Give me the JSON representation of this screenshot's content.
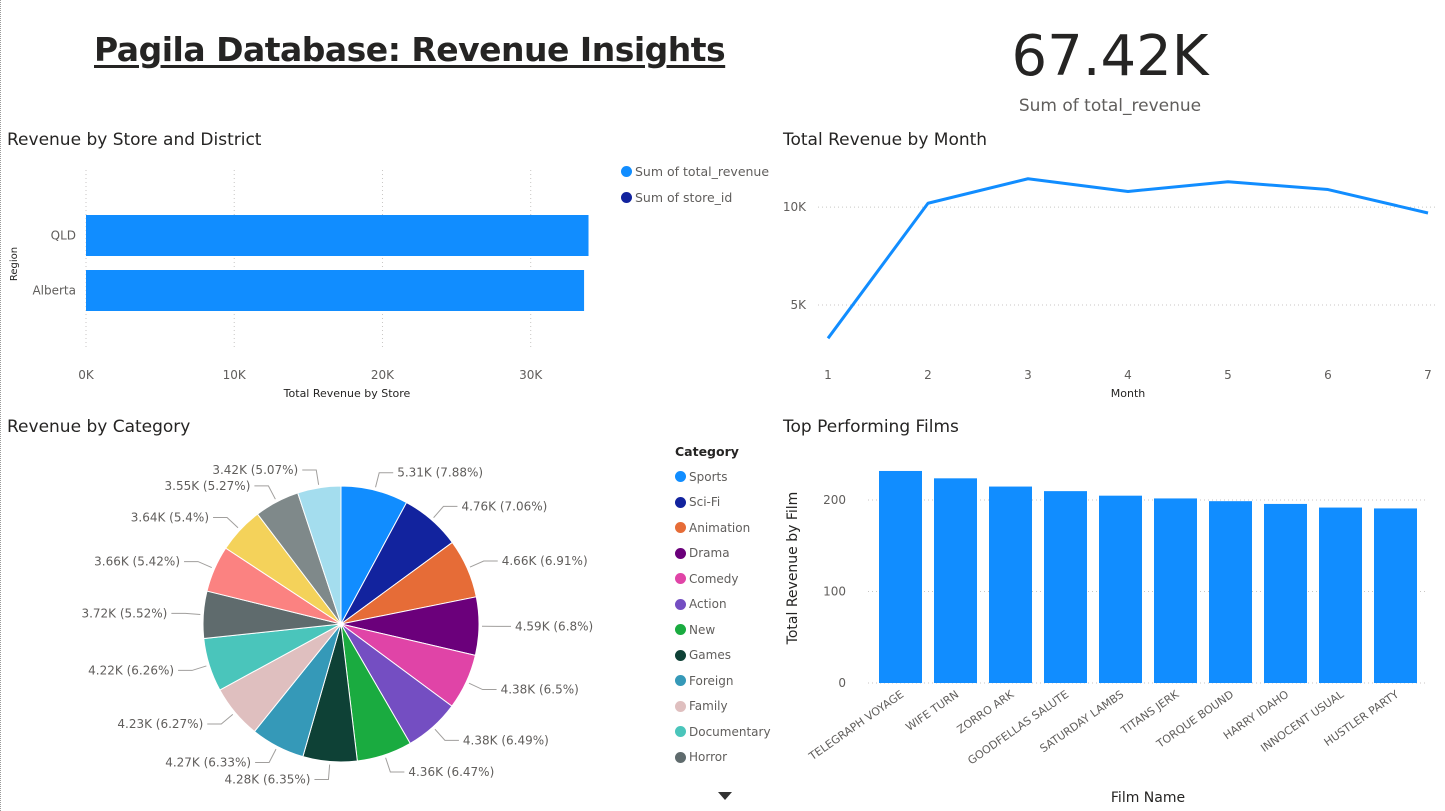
{
  "header": {
    "title": "Pagila Database: Revenue Insights",
    "kpi_value": "67.42K",
    "kpi_label": "Sum of total_revenue"
  },
  "colors": {
    "primary": "#118DFF",
    "secondary": "#12239E",
    "text": "#252423",
    "muted": "#605e5c"
  },
  "chart_data": [
    {
      "type": "bar",
      "orientation": "horizontal",
      "title": "Revenue by Store and District",
      "xlabel": "Total Revenue by Store",
      "ylabel": "Region",
      "categories": [
        "QLD",
        "Alberta"
      ],
      "series": [
        {
          "name": "Sum of total_revenue",
          "color": "#118DFF",
          "values": [
            33900,
            33600
          ]
        },
        {
          "name": "Sum of store_id",
          "color": "#12239E",
          "values": [
            2,
            1
          ]
        }
      ],
      "xlim": [
        0,
        34000
      ],
      "xticks": [
        0,
        10000,
        20000,
        30000
      ],
      "xtick_labels": [
        "0K",
        "10K",
        "20K",
        "30K"
      ],
      "legend": "top-right",
      "grid": true
    },
    {
      "type": "line",
      "title": "Total Revenue by Month",
      "xlabel": "Month",
      "ylabel": "",
      "x": [
        1,
        2,
        3,
        4,
        5,
        6,
        7
      ],
      "series": [
        {
          "name": "",
          "color": "#118DFF",
          "values": [
            3300,
            10200,
            11450,
            10800,
            11300,
            10900,
            9700
          ]
        }
      ],
      "ylim": [
        2600,
        12000
      ],
      "yticks": [
        5000,
        10000
      ],
      "ytick_labels": [
        "5K",
        "10K"
      ],
      "grid": true
    },
    {
      "type": "pie",
      "title": "Revenue by Category",
      "legend_title": "Category",
      "legend": "right",
      "slices": [
        {
          "label": "Sports",
          "value": 5310,
          "text": "5.31K (7.88%)",
          "color": "#118DFF"
        },
        {
          "label": "Sci-Fi",
          "value": 4760,
          "text": "4.76K (7.06%)",
          "color": "#12239E"
        },
        {
          "label": "Animation",
          "value": 4660,
          "text": "4.66K (6.91%)",
          "color": "#E66C37"
        },
        {
          "label": "Drama",
          "value": 4590,
          "text": "4.59K (6.8%)",
          "color": "#6B007B"
        },
        {
          "label": "Comedy",
          "value": 4380,
          "text": "4.38K (6.5%)",
          "color": "#E044A7"
        },
        {
          "label": "Action",
          "value": 4380,
          "text": "4.38K (6.49%)",
          "color": "#744EC2"
        },
        {
          "label": "New",
          "value": 4360,
          "text": "4.36K (6.47%)",
          "color": "#1AAB40"
        },
        {
          "label": "Games",
          "value": 4280,
          "text": "4.28K (6.35%)",
          "color": "#0E4136"
        },
        {
          "label": "Foreign",
          "value": 4270,
          "text": "4.27K (6.33%)",
          "color": "#3599B8"
        },
        {
          "label": "Family",
          "value": 4230,
          "text": "4.23K (6.27%)",
          "color": "#DFBFBF"
        },
        {
          "label": "Documentary",
          "value": 4220,
          "text": "4.22K (6.26%)",
          "color": "#4AC5BB"
        },
        {
          "label": "Horror",
          "value": 3720,
          "text": "3.72K (5.52%)",
          "color": "#5F6B6D"
        },
        {
          "label": "",
          "value": 3660,
          "text": "3.66K (5.42%)",
          "color": "#FB8281"
        },
        {
          "label": "",
          "value": 3640,
          "text": "3.64K (5.4%)",
          "color": "#F4D25A"
        },
        {
          "label": "",
          "value": 3550,
          "text": "3.55K (5.27%)",
          "color": "#7F898A"
        },
        {
          "label": "",
          "value": 3420,
          "text": "3.42K (5.07%)",
          "color": "#A4DDEE"
        }
      ],
      "legend_items": [
        "Sports",
        "Sci-Fi",
        "Animation",
        "Drama",
        "Comedy",
        "Action",
        "New",
        "Games",
        "Foreign",
        "Family",
        "Documentary",
        "Horror"
      ]
    },
    {
      "type": "bar",
      "orientation": "vertical",
      "title": "Top Performing Films",
      "xlabel": "Film Name",
      "ylabel": "Total Revenue by Film",
      "categories": [
        "TELEGRAPH VOYAGE",
        "WIFE TURN",
        "ZORRO ARK",
        "GOODFELLAS SALUTE",
        "SATURDAY LAMBS",
        "TITANS JERK",
        "TORQUE BOUND",
        "HARRY IDAHO",
        "INNOCENT USUAL",
        "HUSTLER PARTY"
      ],
      "series": [
        {
          "name": "",
          "color": "#118DFF",
          "values": [
            231.73,
            223.69,
            214.69,
            209.69,
            204.72,
            201.71,
            198.72,
            195.7,
            191.74,
            190.78
          ]
        }
      ],
      "ylim": [
        0,
        240
      ],
      "yticks": [
        0,
        100,
        200
      ],
      "ytick_labels": [
        "0",
        "100",
        "200"
      ],
      "grid": true
    }
  ]
}
